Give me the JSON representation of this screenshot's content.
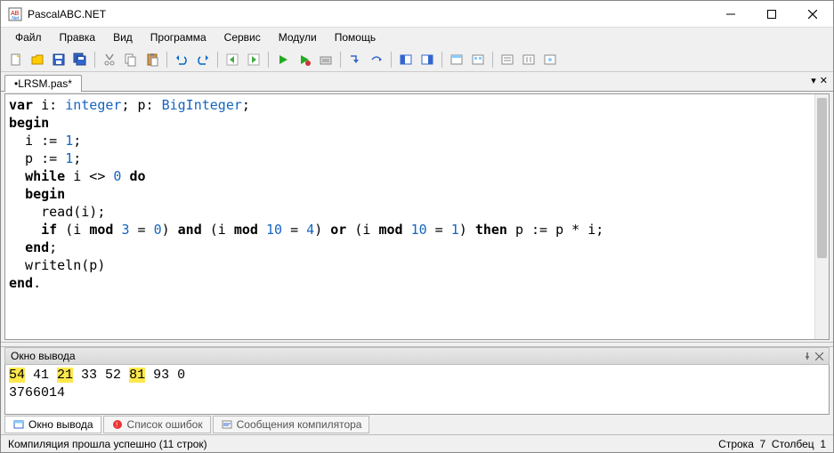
{
  "window": {
    "title": "PascalABC.NET"
  },
  "menu": {
    "items": [
      "Файл",
      "Правка",
      "Вид",
      "Программа",
      "Сервис",
      "Модули",
      "Помощь"
    ]
  },
  "tabs": {
    "active": "•LRSM.pas*"
  },
  "code_tokens": [
    [
      {
        "t": "var",
        "c": "kw"
      },
      {
        "t": " i: "
      },
      {
        "t": "integer",
        "c": "typ"
      },
      {
        "t": "; p: "
      },
      {
        "t": "BigInteger",
        "c": "typ"
      },
      {
        "t": ";"
      }
    ],
    [
      {
        "t": "begin",
        "c": "kw"
      }
    ],
    [
      {
        "t": "  i := "
      },
      {
        "t": "1",
        "c": "num"
      },
      {
        "t": ";"
      }
    ],
    [
      {
        "t": "  p := "
      },
      {
        "t": "1",
        "c": "num"
      },
      {
        "t": ";"
      }
    ],
    [
      {
        "t": "  "
      },
      {
        "t": "while",
        "c": "kw"
      },
      {
        "t": " i <> "
      },
      {
        "t": "0",
        "c": "num"
      },
      {
        "t": " "
      },
      {
        "t": "do",
        "c": "kw"
      }
    ],
    [
      {
        "t": "  "
      },
      {
        "t": "begin",
        "c": "kw"
      }
    ],
    [
      {
        "t": "    read(i);"
      }
    ],
    [
      {
        "t": "    "
      },
      {
        "t": "if",
        "c": "kw"
      },
      {
        "t": " (i "
      },
      {
        "t": "mod",
        "c": "kw"
      },
      {
        "t": " "
      },
      {
        "t": "3",
        "c": "num"
      },
      {
        "t": " = "
      },
      {
        "t": "0",
        "c": "num"
      },
      {
        "t": ") "
      },
      {
        "t": "and",
        "c": "kw"
      },
      {
        "t": " (i "
      },
      {
        "t": "mod",
        "c": "kw"
      },
      {
        "t": " "
      },
      {
        "t": "10",
        "c": "num"
      },
      {
        "t": " = "
      },
      {
        "t": "4",
        "c": "num"
      },
      {
        "t": ") "
      },
      {
        "t": "or",
        "c": "kw"
      },
      {
        "t": " (i "
      },
      {
        "t": "mod",
        "c": "kw"
      },
      {
        "t": " "
      },
      {
        "t": "10",
        "c": "num"
      },
      {
        "t": " = "
      },
      {
        "t": "1",
        "c": "num"
      },
      {
        "t": ") "
      },
      {
        "t": "then",
        "c": "kw"
      },
      {
        "t": " p := p * i;"
      }
    ],
    [
      {
        "t": "  "
      },
      {
        "t": "end",
        "c": "kw"
      },
      {
        "t": ";"
      }
    ],
    [
      {
        "t": "  writeln(p)"
      }
    ],
    [
      {
        "t": "end",
        "c": "kw"
      },
      {
        "t": "."
      }
    ]
  ],
  "output": {
    "title": "Окно вывода",
    "line1": [
      {
        "t": "54",
        "hl": true
      },
      {
        "t": " 41 "
      },
      {
        "t": "21",
        "hl": true
      },
      {
        "t": " 33 52 "
      },
      {
        "t": "81",
        "hl": true
      },
      {
        "t": " 93 0"
      }
    ],
    "line2": "3766014"
  },
  "bottom_tabs": {
    "items": [
      "Окно вывода",
      "Список ошибок",
      "Сообщения компилятора"
    ]
  },
  "status": {
    "left": "Компиляция прошла успешно (11 строк)",
    "right_line_label": "Строка",
    "right_line": "7",
    "right_col_label": "Столбец",
    "right_col": "1"
  }
}
